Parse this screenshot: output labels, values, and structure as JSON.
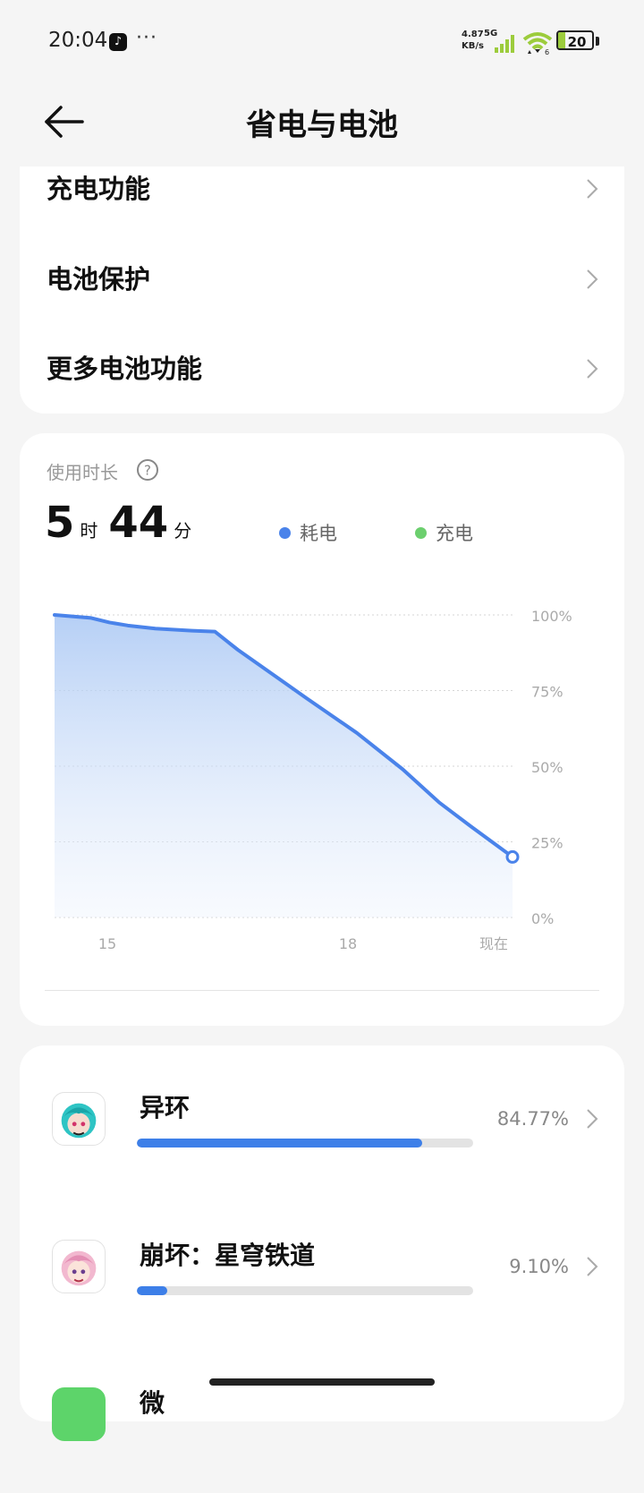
{
  "status_bar": {
    "time": "20:04",
    "net_speed_value": "4.87",
    "net_speed_unit": "KB/s",
    "network_type": "5G",
    "wifi_label": "6",
    "battery_level": "20",
    "battery_fill_percent": 20,
    "battery_color": "#9ccc3c"
  },
  "header": {
    "title": "省电与电池",
    "back_icon": "arrow-left-icon"
  },
  "settings": {
    "items": [
      {
        "label": "充电功能"
      },
      {
        "label": "电池保护"
      },
      {
        "label": "更多电池功能"
      }
    ]
  },
  "usage": {
    "title": "使用时长",
    "hours": "5",
    "hours_unit": "时",
    "minutes": "44",
    "minutes_unit": "分",
    "legend": [
      {
        "label": "耗电",
        "color": "#4a83ea"
      },
      {
        "label": "充电",
        "color": "#6ccf6e"
      }
    ]
  },
  "chart_data": {
    "type": "area",
    "x_tick_labels": [
      "15",
      "18",
      "现在"
    ],
    "y_tick_labels": [
      "100%",
      "75%",
      "50%",
      "25%",
      "0%"
    ],
    "ylim": [
      0,
      100
    ],
    "grid": true,
    "series": [
      {
        "name": "耗电",
        "color": "#4a83ea",
        "x": [
          0,
          0.08,
          0.12,
          0.16,
          0.22,
          0.3,
          0.35,
          0.4,
          0.55,
          0.66,
          0.76,
          0.84,
          0.91,
          1.0
        ],
        "values": [
          100,
          99,
          97.5,
          96.5,
          95.5,
          94.8,
          94.5,
          88.5,
          72.5,
          61,
          49,
          38,
          30,
          20
        ]
      }
    ]
  },
  "apps": [
    {
      "name": "异环",
      "percent_text": "84.77%",
      "percent": 84.77,
      "icon": "cyan-hair-anime-avatar-icon"
    },
    {
      "name": "崩坏：星穹铁道",
      "percent_text": "9.10%",
      "percent": 9.1,
      "icon": "pink-hair-anime-avatar-icon"
    },
    {
      "name": "微",
      "percent_text": "",
      "percent": 0,
      "icon": "green-app-icon"
    }
  ]
}
